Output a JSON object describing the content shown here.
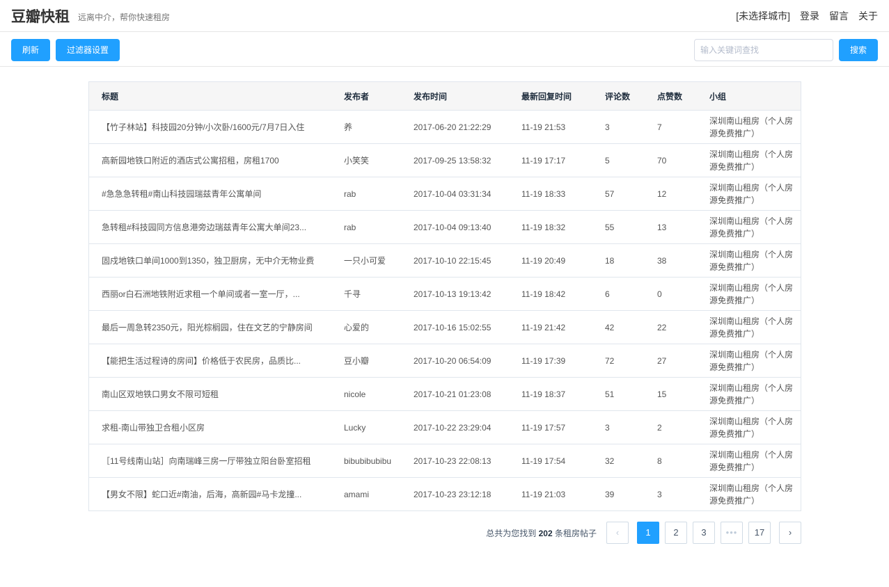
{
  "header": {
    "logo": "豆瓣快租",
    "slogan": "远离中介，帮你快速租房",
    "nav": [
      "[未选择城市]",
      "登录",
      "留言",
      "关于"
    ]
  },
  "toolbar": {
    "refresh_label": "刷新",
    "filter_label": "过滤器设置",
    "search_placeholder": "输入关键词查找",
    "search_label": "搜索"
  },
  "table": {
    "columns": [
      "标题",
      "发布者",
      "发布时间",
      "最新回复时间",
      "评论数",
      "点赞数",
      "小组"
    ],
    "rows": [
      [
        "【竹子林站】科技园20分钟/小次卧/1600元/7月7日入住",
        "养",
        "2017-06-20 21:22:29",
        "11-19 21:53",
        "3",
        "7",
        "深圳南山租房（个人房源免费推广）"
      ],
      [
        "高新园地铁口附近的酒店式公寓招租，房租1700",
        "小笑笑",
        "2017-09-25 13:58:32",
        "11-19 17:17",
        "5",
        "70",
        "深圳南山租房（个人房源免费推广）"
      ],
      [
        "#急急急转租#南山科技园瑞兹青年公寓单间",
        "rab",
        "2017-10-04 03:31:34",
        "11-19 18:33",
        "57",
        "12",
        "深圳南山租房（个人房源免费推广）"
      ],
      [
        "急转租#科技园同方信息港旁边瑞兹青年公寓大单间23...",
        "rab",
        "2017-10-04 09:13:40",
        "11-19 18:32",
        "55",
        "13",
        "深圳南山租房（个人房源免费推广）"
      ],
      [
        "固戍地铁口单间1000到1350，独卫厨房，无中介无物业费",
        "一只小可爱",
        "2017-10-10 22:15:45",
        "11-19 20:49",
        "18",
        "38",
        "深圳南山租房（个人房源免费推广）"
      ],
      [
        "西丽or白石洲地铁附近求租一个单间或者一室一厅，...",
        "千寻",
        "2017-10-13 19:13:42",
        "11-19 18:42",
        "6",
        "0",
        "深圳南山租房（个人房源免费推广）"
      ],
      [
        "最后一周急转2350元，阳光棕榈园，住在文艺的宁静房间",
        "心爱的",
        "2017-10-16 15:02:55",
        "11-19 21:42",
        "42",
        "22",
        "深圳南山租房（个人房源免费推广）"
      ],
      [
        "【能把生活过程诗的房间】价格低于农民房，品质比...",
        "豆小瓣",
        "2017-10-20 06:54:09",
        "11-19 17:39",
        "72",
        "27",
        "深圳南山租房（个人房源免费推广）"
      ],
      [
        "南山区双地铁口男女不限可短租",
        "nicole",
        "2017-10-21 01:23:08",
        "11-19 18:37",
        "51",
        "15",
        "深圳南山租房（个人房源免费推广）"
      ],
      [
        "求租-南山带独卫合租小区房",
        "Lucky",
        "2017-10-22 23:29:04",
        "11-19 17:57",
        "3",
        "2",
        "深圳南山租房（个人房源免费推广）"
      ],
      [
        "［11号线南山站］向南瑞峰三房一厅带独立阳台卧室招租",
        "bibubibubibu",
        "2017-10-23 22:08:13",
        "11-19 17:54",
        "32",
        "8",
        "深圳南山租房（个人房源免费推广）"
      ],
      [
        "【男女不限】蛇口近#南油，后海，高新园#马卡龙撞...",
        "amami",
        "2017-10-23 23:12:18",
        "11-19 21:03",
        "39",
        "3",
        "深圳南山租房（个人房源免费推广）"
      ]
    ]
  },
  "pagination": {
    "total_prefix": "总共为您找到",
    "total_count": "202",
    "total_suffix": "条租房帖子",
    "prev_icon": "‹",
    "next_icon": "›",
    "pages": [
      "1",
      "2",
      "3",
      "•••",
      "17"
    ],
    "current": "1"
  },
  "colors": {
    "accent": "#20a0ff"
  }
}
